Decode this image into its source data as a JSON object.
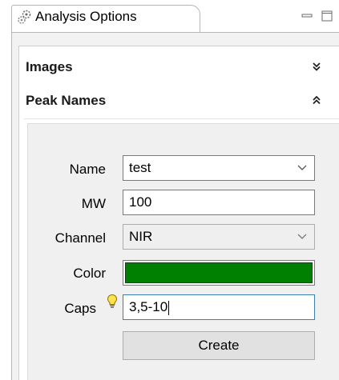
{
  "view": {
    "title": "Analysis Options",
    "icon": "gears-icon"
  },
  "window_controls": [
    "minimize-icon",
    "maximize-icon"
  ],
  "sections": [
    {
      "title": "Images",
      "state": "collapsed",
      "icon": "double-chevron-down-icon"
    },
    {
      "title": "Peak Names",
      "state": "expanded",
      "icon": "double-chevron-up-icon"
    }
  ],
  "form": {
    "name": {
      "label": "Name",
      "value": "test"
    },
    "mw": {
      "label": "MW",
      "value": "100"
    },
    "channel": {
      "label": "Channel",
      "value": "NIR"
    },
    "color": {
      "label": "Color",
      "value": "#008000"
    },
    "caps": {
      "label": "Caps",
      "value": "3,5-10",
      "hint_icon": "lightbulb-icon"
    },
    "create_label": "Create"
  }
}
